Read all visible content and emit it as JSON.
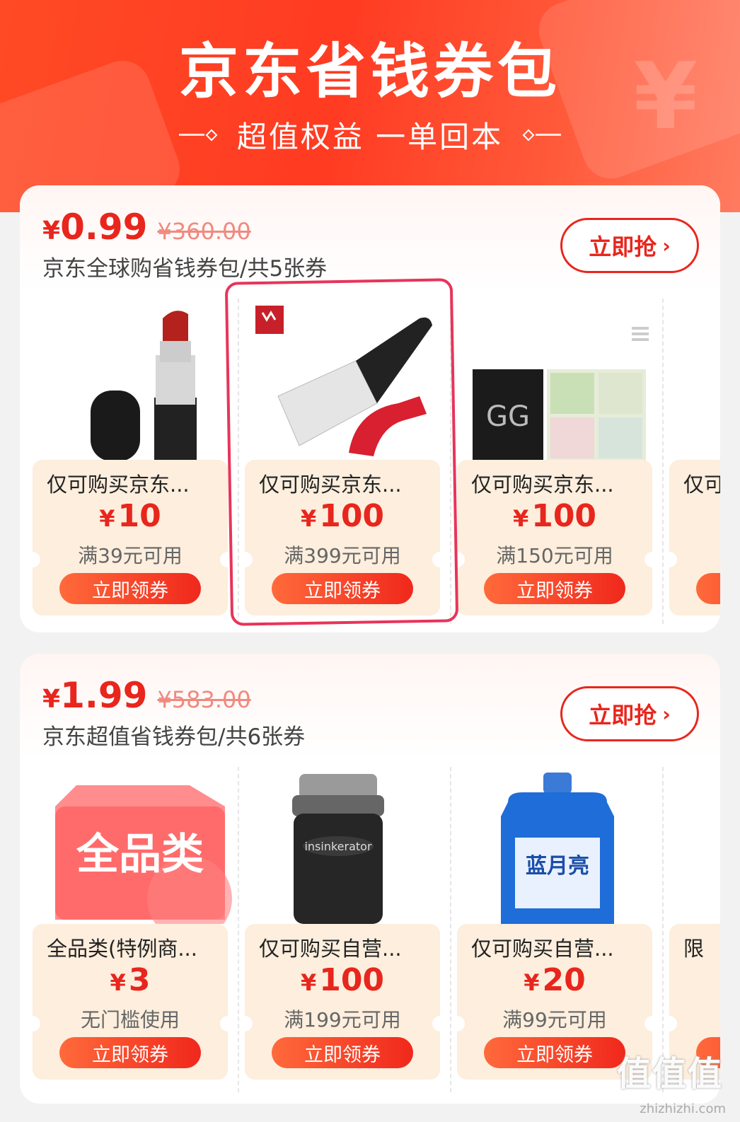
{
  "banner": {
    "title": "京东省钱券包",
    "subtitle": "超值权益 一单回本"
  },
  "packs": [
    {
      "currency": "¥",
      "price": "0.99",
      "original_price": "¥360.00",
      "description": "京东全球购省钱券包/共5张券",
      "grab_label": "立即抢",
      "claim_label": "立即领券",
      "coupons": [
        {
          "title": "仅可购买京东...",
          "value": "10",
          "condition": "满39元可用"
        },
        {
          "title": "仅可购买京东...",
          "value": "100",
          "condition": "满399元可用"
        },
        {
          "title": "仅可购买京东...",
          "value": "100",
          "condition": "满150元可用"
        },
        {
          "title": "仅可"
        }
      ]
    },
    {
      "currency": "¥",
      "price": "1.99",
      "original_price": "¥583.00",
      "description": "京东超值省钱券包/共6张券",
      "grab_label": "立即抢",
      "claim_label": "立即领券",
      "badge_text": "全品类",
      "detergent_brand": "蓝月亮",
      "coupons": [
        {
          "title": "全品类(特例商...",
          "value": "3",
          "condition": "无门槛使用"
        },
        {
          "title": "仅可购买自营...",
          "value": "100",
          "condition": "满199元可用"
        },
        {
          "title": "仅可购买自营...",
          "value": "20",
          "condition": "满99元可用"
        },
        {
          "title": "限"
        }
      ]
    }
  ],
  "watermark": {
    "logo": "值值值",
    "url": "zhizhizhi.com"
  },
  "colors": {
    "accent_red": "#e8261d",
    "banner_orange": "#ff4a25",
    "coupon_bg": "#fdeedd",
    "highlight_pink": "#e8345a"
  }
}
